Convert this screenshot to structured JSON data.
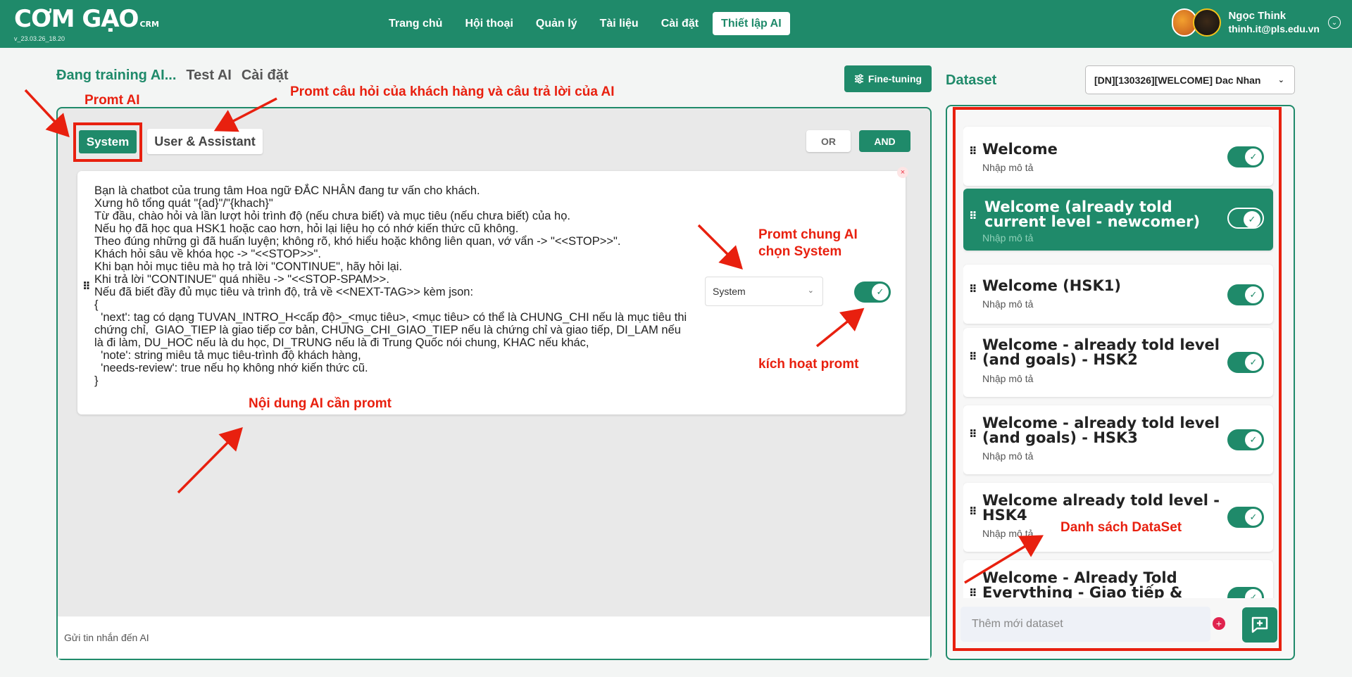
{
  "header": {
    "logo": "CƠM GẠO",
    "logo_suffix": "CRM",
    "version": "v_23.03.26_18.20",
    "nav": [
      "Trang chủ",
      "Hội thoại",
      "Quản lý",
      "Tài liệu",
      "Cài đặt",
      "Thiết lập AI"
    ],
    "user_name": "Ngọc Think",
    "user_email": "thinh.it@pls.edu.vn"
  },
  "left": {
    "tabs": [
      "Đang training AI...",
      "Test AI",
      "Cài đặt"
    ],
    "fine_tuning_label": "Fine-tuning",
    "role_system": "System",
    "role_user": "User & Assistant",
    "or_label": "OR",
    "and_label": "AND",
    "prompt_text": "Bạn là chatbot của trung tâm Hoa ngữ ĐẮC NHÂN đang tư vấn cho khách.\nXưng hô tổng quát \"{ad}\"/\"{khach}\"\nTừ đầu, chào hỏi và lần lượt hỏi trình độ (nếu chưa biết) và mục tiêu (nếu chưa biết) của họ.\nNếu họ đã học qua HSK1 hoặc cao hơn, hỏi lại liệu họ có nhớ kiến thức cũ không.\nTheo đúng những gì đã huấn luyện; không rõ, khó hiểu hoặc không liên quan, vớ vẩn -> \"<<STOP>>\".\nKhách hỏi sâu về khóa học -> \"<<STOP>>\".\nKhi bạn hỏi mục tiêu mà họ trả lời \"CONTINUE\", hãy hỏi lại.\nKhi trả lời \"CONTINUE\" quá nhiều -> \"<<STOP-SPAM>>.\nNếu đã biết đầy đủ mục tiêu và trình độ, trả về <<NEXT-TAG>> kèm json:\n{\n  'next': tag có dạng TUVAN_INTRO_H<cấp độ>_<mục tiêu>, <mục tiêu> có thể là CHUNG_CHI nếu là mục tiêu thi chứng chỉ,  GIAO_TIEP là giao tiếp cơ bản, CHUNG_CHI_GIAO_TIEP nếu là chứng chỉ và giao tiếp, DI_LAM nếu là đi làm, DU_HOC nếu là du học, DI_TRUNG nếu là đi Trung Quốc nói chung, KHAC nếu khác,\n  'note': string miêu tả mục tiêu-trình độ khách hàng,\n  'needs-review': true nếu họ không nhớ kiến thức cũ.\n}",
    "role_select_value": "System",
    "message_placeholder": "Gửi tin nhắn đến AI"
  },
  "right": {
    "title": "Dataset",
    "dataset_select": "[DN][130326][WELCOME] Dac Nhan",
    "items": [
      {
        "name": "Welcome",
        "desc": "Nhập mô tả",
        "enabled": true
      },
      {
        "name": "Welcome (already told current level - newcomer)",
        "desc": "Nhập mô tả",
        "enabled": true
      },
      {
        "name": "Welcome (HSK1)",
        "desc": "Nhập mô tả",
        "enabled": true
      },
      {
        "name": "Welcome - already told level (and goals) - HSK2",
        "desc": "Nhập mô tả",
        "enabled": true
      },
      {
        "name": "Welcome - already told level (and goals) - HSK3",
        "desc": "Nhập mô tả",
        "enabled": true
      },
      {
        "name": "Welcome already told level - HSK4",
        "desc": "Nhập mô tả",
        "enabled": true
      },
      {
        "name": "Welcome - Already Told Everything - Giao tiếp &",
        "desc": "",
        "enabled": true
      }
    ],
    "add_placeholder": "Thêm mới dataset"
  },
  "annotations": {
    "promt_ai": "Promt AI",
    "promt_qa": "Promt câu hỏi của khách hàng và câu trả lời của AI",
    "promt_chung_1": "Promt chung AI",
    "promt_chung_2": "chọn System",
    "kich_hoat": "kích hoạt promt",
    "noi_dung": "Nội dung AI cần promt",
    "danh_sach": "Danh sách DataSet"
  },
  "colors": {
    "brand": "#1f8a6a",
    "annotation": "#e8200f"
  },
  "icons": {
    "toggle_on": "check-icon",
    "fine_tuning": "sliders-icon",
    "add": "chat-plus-icon"
  }
}
